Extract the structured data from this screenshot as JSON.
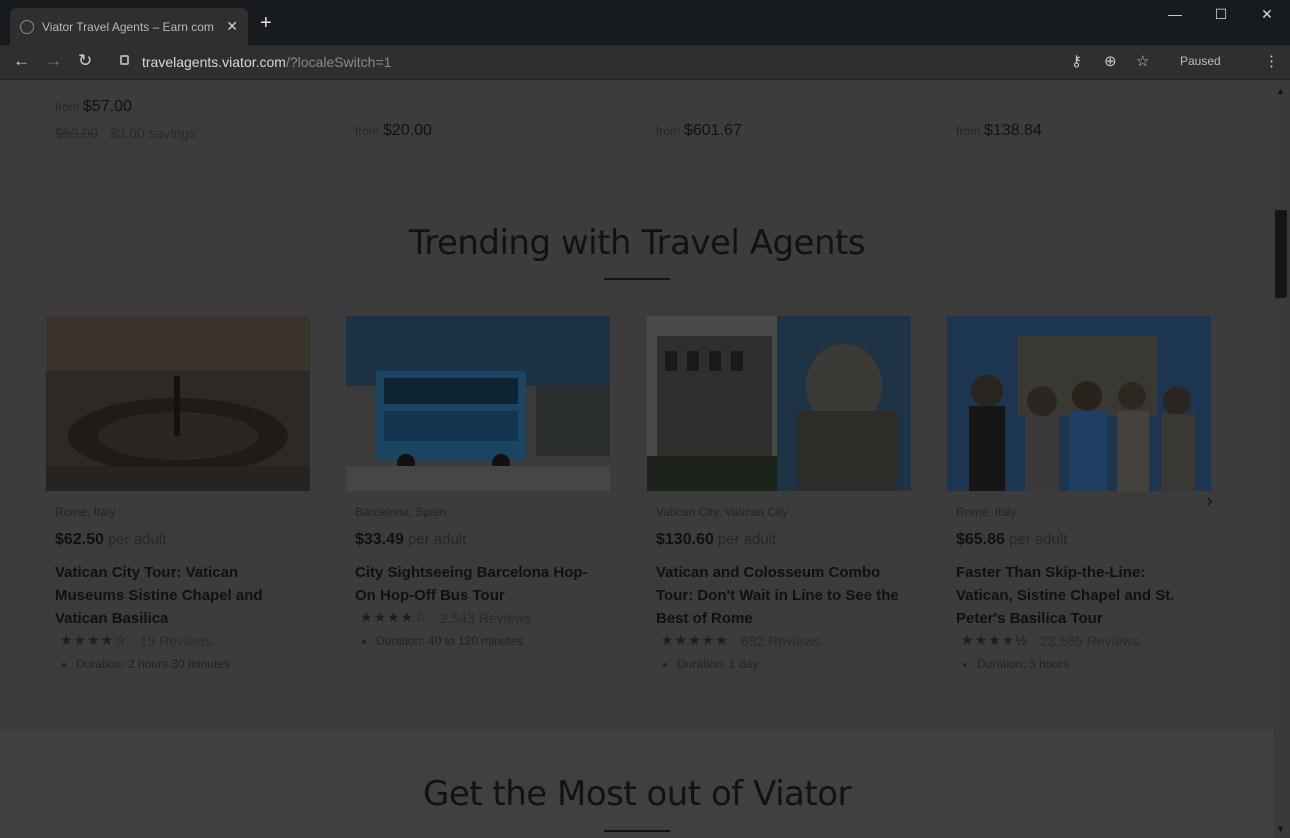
{
  "browser": {
    "tab_title": "Viator Travel Agents – Earn com",
    "tab_close": "✕",
    "new_tab": "+",
    "url_host": "travelagents.viator.com",
    "url_path": "/?localeSwitch=1",
    "profile_status": "Paused",
    "window_controls": {
      "minimize": "—",
      "maximize": "☐",
      "close": "✕"
    }
  },
  "top_prices": [
    {
      "prefix": "from",
      "amount": "$57.00",
      "old": "$60.00",
      "savings": "$3.00 savings"
    },
    {
      "prefix": "from",
      "amount": "$20.00"
    },
    {
      "prefix": "from",
      "amount": "$601.67"
    },
    {
      "prefix": "from",
      "amount": "$138.84"
    }
  ],
  "trending": {
    "title": "Trending with Travel Agents",
    "cards": [
      {
        "location": "Rome, Italy",
        "price": "$62.50",
        "per": "per adult",
        "name": "Vatican City Tour: Vatican Museums Sistine Chapel and Vatican Basilica",
        "stars": "★★★★☆",
        "reviews": "19 Reviews",
        "duration": "Duration: 2 hours 30 minutes",
        "rating": 4
      },
      {
        "location": "Barcelona, Spain",
        "price": "$33.49",
        "per": "per adult",
        "name": "City Sightseeing Barcelona Hop-On Hop-Off Bus Tour",
        "stars": "★★★★☆",
        "reviews": "2,543 Reviews",
        "duration": "Duration: 40 to 120 minutes",
        "rating": 4
      },
      {
        "location": "Vatican City, Vatican City",
        "price": "$130.60",
        "per": "per adult",
        "name": "Vatican and Colosseum Combo Tour: Don't Wait in Line to See the Best of Rome",
        "stars": "★★★★★",
        "reviews": "682 Reviews",
        "duration": "Duration: 1 day",
        "rating": 5
      },
      {
        "location": "Rome, Italy",
        "price": "$65.86",
        "per": "per adult",
        "name": "Faster Than Skip-the-Line: Vatican, Sistine Chapel and St. Peter's Basilica Tour",
        "stars": "★★★★½",
        "reviews": "23,565 Reviews",
        "duration": "Duration: 3 hours",
        "rating": 4.5
      }
    ],
    "next_arrow": "›"
  },
  "most_out": {
    "title": "Get the Most out of Viator"
  },
  "icons": {
    "back": "back-arrow-icon",
    "forward": "forward-arrow-icon",
    "reload": "reload-icon",
    "key": "key-icon",
    "zoom": "zoom-icon",
    "star": "bookmark-star-icon",
    "menu": "menu-dots-icon"
  }
}
